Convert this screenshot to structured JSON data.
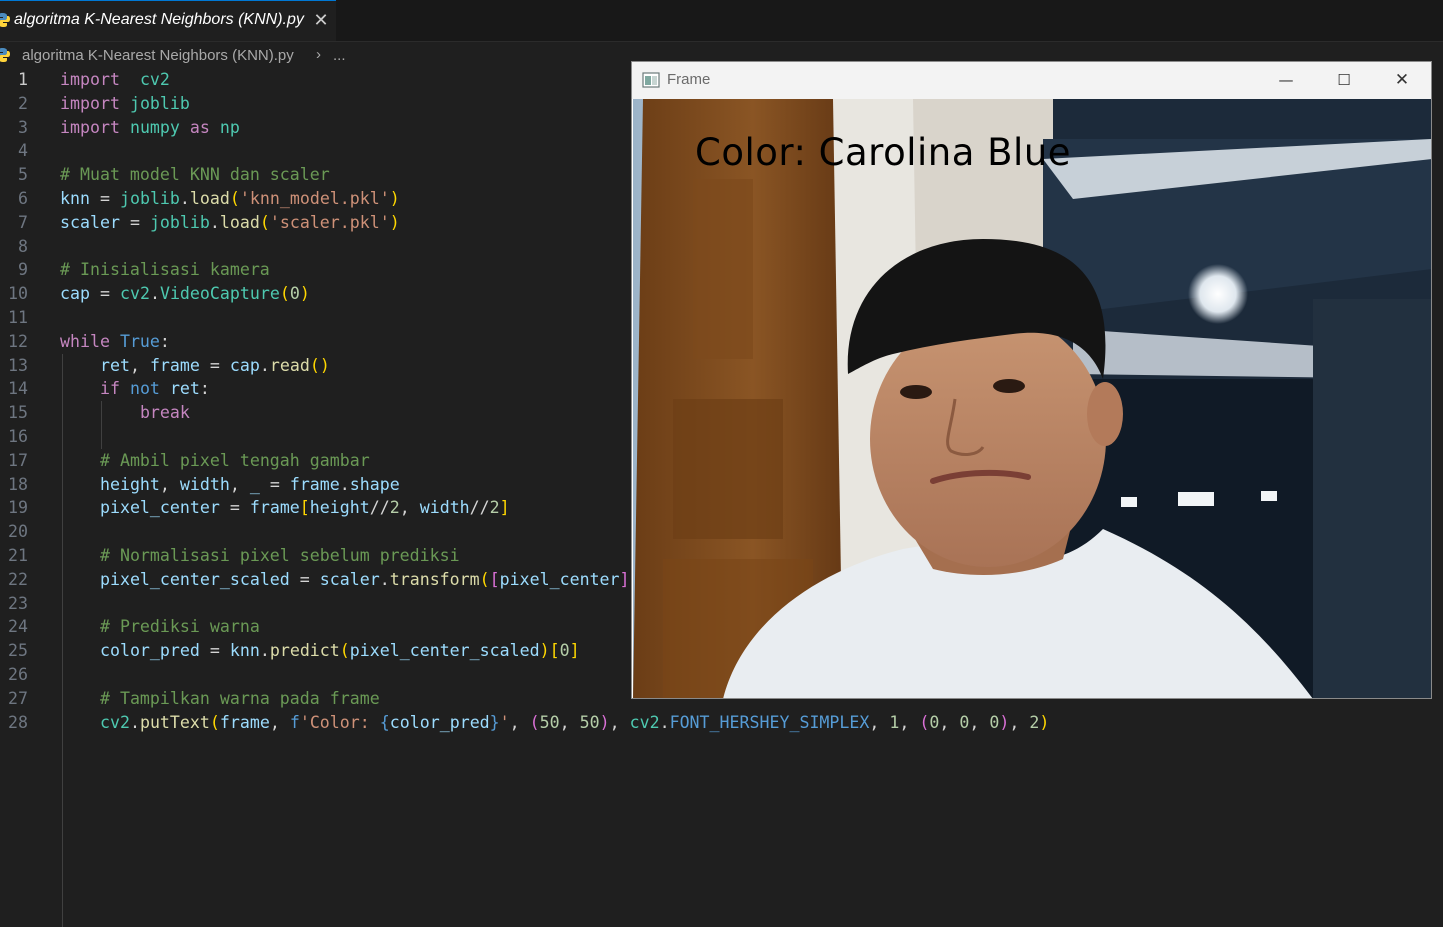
{
  "tab": {
    "filename": "algoritma K-Nearest Neighbors (KNN).py",
    "close_glyph": "✕"
  },
  "breadcrumb": {
    "file": "algoritma K-Nearest Neighbors (KNN).py",
    "separator": "›",
    "more": "..."
  },
  "editor": {
    "active_line": 1,
    "lines": [
      {
        "n": "1",
        "t": [
          [
            "kw",
            "import"
          ],
          [
            "",
            "  "
          ],
          [
            "mod",
            "cv2"
          ]
        ]
      },
      {
        "n": "2",
        "t": [
          [
            "kw",
            "import"
          ],
          [
            "",
            " "
          ],
          [
            "mod",
            "joblib"
          ]
        ]
      },
      {
        "n": "3",
        "t": [
          [
            "kw",
            "import"
          ],
          [
            "",
            " "
          ],
          [
            "mod",
            "numpy"
          ],
          [
            "",
            " "
          ],
          [
            "kw",
            "as"
          ],
          [
            "",
            " "
          ],
          [
            "mod",
            "np"
          ]
        ]
      },
      {
        "n": "4",
        "t": []
      },
      {
        "n": "5",
        "t": [
          [
            "com",
            "# Muat model KNN dan scaler"
          ]
        ]
      },
      {
        "n": "6",
        "t": [
          [
            "var",
            "knn"
          ],
          [
            "",
            " = "
          ],
          [
            "mod",
            "joblib"
          ],
          [
            "",
            "."
          ],
          [
            "fn",
            "load"
          ],
          [
            "b1",
            "("
          ],
          [
            "str",
            "'knn_model.pkl'"
          ],
          [
            "b1",
            ")"
          ]
        ]
      },
      {
        "n": "7",
        "t": [
          [
            "var",
            "scaler"
          ],
          [
            "",
            " = "
          ],
          [
            "mod",
            "joblib"
          ],
          [
            "",
            "."
          ],
          [
            "fn",
            "load"
          ],
          [
            "b1",
            "("
          ],
          [
            "str",
            "'scaler.pkl'"
          ],
          [
            "b1",
            ")"
          ]
        ]
      },
      {
        "n": "8",
        "t": []
      },
      {
        "n": "9",
        "t": [
          [
            "com",
            "# Inisialisasi kamera"
          ]
        ]
      },
      {
        "n": "10",
        "t": [
          [
            "var",
            "cap"
          ],
          [
            "",
            " = "
          ],
          [
            "mod",
            "cv2"
          ],
          [
            "",
            "."
          ],
          [
            "mod",
            "VideoCapture"
          ],
          [
            "b1",
            "("
          ],
          [
            "num",
            "0"
          ],
          [
            "b1",
            ")"
          ]
        ]
      },
      {
        "n": "11",
        "t": []
      },
      {
        "n": "12",
        "t": [
          [
            "kw",
            "while"
          ],
          [
            "",
            " "
          ],
          [
            "bk",
            "True"
          ],
          [
            "",
            ":"
          ]
        ]
      },
      {
        "n": "13",
        "t": [
          [
            "",
            "    "
          ],
          [
            "var",
            "ret"
          ],
          [
            "",
            ", "
          ],
          [
            "var",
            "frame"
          ],
          [
            "",
            " = "
          ],
          [
            "var",
            "cap"
          ],
          [
            "",
            "."
          ],
          [
            "fn",
            "read"
          ],
          [
            "b1",
            "()"
          ]
        ]
      },
      {
        "n": "14",
        "t": [
          [
            "",
            "    "
          ],
          [
            "kw",
            "if"
          ],
          [
            "",
            " "
          ],
          [
            "bk",
            "not"
          ],
          [
            "",
            " "
          ],
          [
            "var",
            "ret"
          ],
          [
            "",
            ":"
          ]
        ]
      },
      {
        "n": "15",
        "t": [
          [
            "",
            "        "
          ],
          [
            "kw",
            "break"
          ]
        ]
      },
      {
        "n": "16",
        "t": []
      },
      {
        "n": "17",
        "t": [
          [
            "",
            "    "
          ],
          [
            "com",
            "# Ambil pixel tengah gambar"
          ]
        ]
      },
      {
        "n": "18",
        "t": [
          [
            "",
            "    "
          ],
          [
            "var",
            "height"
          ],
          [
            "",
            ", "
          ],
          [
            "var",
            "width"
          ],
          [
            "",
            ", "
          ],
          [
            "var",
            "_"
          ],
          [
            "",
            " = "
          ],
          [
            "var",
            "frame"
          ],
          [
            "",
            "."
          ],
          [
            "var",
            "shape"
          ]
        ]
      },
      {
        "n": "19",
        "t": [
          [
            "",
            "    "
          ],
          [
            "var",
            "pixel_center"
          ],
          [
            "",
            " = "
          ],
          [
            "var",
            "frame"
          ],
          [
            "b1",
            "["
          ],
          [
            "var",
            "height"
          ],
          [
            "",
            "//"
          ],
          [
            "num",
            "2"
          ],
          [
            "",
            ", "
          ],
          [
            "var",
            "width"
          ],
          [
            "",
            "//"
          ],
          [
            "num",
            "2"
          ],
          [
            "b1",
            "]"
          ]
        ]
      },
      {
        "n": "20",
        "t": []
      },
      {
        "n": "21",
        "t": [
          [
            "",
            "    "
          ],
          [
            "com",
            "# Normalisasi pixel sebelum prediksi"
          ]
        ]
      },
      {
        "n": "22",
        "t": [
          [
            "",
            "    "
          ],
          [
            "var",
            "pixel_center_scaled"
          ],
          [
            "",
            " = "
          ],
          [
            "var",
            "scaler"
          ],
          [
            "",
            "."
          ],
          [
            "fn",
            "transform"
          ],
          [
            "b1",
            "("
          ],
          [
            "b2",
            "["
          ],
          [
            "var",
            "pixel_center"
          ],
          [
            "b2",
            "]"
          ],
          [
            "b1",
            ")"
          ]
        ]
      },
      {
        "n": "23",
        "t": []
      },
      {
        "n": "24",
        "t": [
          [
            "",
            "    "
          ],
          [
            "com",
            "# Prediksi warna"
          ]
        ]
      },
      {
        "n": "25",
        "t": [
          [
            "",
            "    "
          ],
          [
            "var",
            "color_pred"
          ],
          [
            "",
            " = "
          ],
          [
            "var",
            "knn"
          ],
          [
            "",
            "."
          ],
          [
            "fn",
            "predict"
          ],
          [
            "b1",
            "("
          ],
          [
            "var",
            "pixel_center_scaled"
          ],
          [
            "b1",
            ")"
          ],
          [
            "b1",
            "["
          ],
          [
            "num",
            "0"
          ],
          [
            "b1",
            "]"
          ]
        ]
      },
      {
        "n": "26",
        "t": []
      },
      {
        "n": "27",
        "t": [
          [
            "",
            "    "
          ],
          [
            "com",
            "# Tampilkan warna pada frame"
          ]
        ]
      },
      {
        "n": "28",
        "t": [
          [
            "",
            "    "
          ],
          [
            "mod",
            "cv2"
          ],
          [
            "",
            "."
          ],
          [
            "fn",
            "putText"
          ],
          [
            "b1",
            "("
          ],
          [
            "var",
            "frame"
          ],
          [
            "",
            ", "
          ],
          [
            "bk",
            "f"
          ],
          [
            "str",
            "'Color: "
          ],
          [
            "bk",
            "{"
          ],
          [
            "var",
            "color_pred"
          ],
          [
            "bk",
            "}"
          ],
          [
            "str",
            "'"
          ],
          [
            "",
            ", "
          ],
          [
            "b2",
            "("
          ],
          [
            "num",
            "50"
          ],
          [
            "",
            ", "
          ],
          [
            "num",
            "50"
          ],
          [
            "b2",
            ")"
          ],
          [
            "",
            ", "
          ],
          [
            "mod",
            "cv2"
          ],
          [
            "",
            "."
          ],
          [
            "bk",
            "FONT_HERSHEY_SIMPLEX"
          ],
          [
            "",
            ", "
          ],
          [
            "num",
            "1"
          ],
          [
            "",
            ", "
          ],
          [
            "b2",
            "("
          ],
          [
            "num",
            "0"
          ],
          [
            "",
            ", "
          ],
          [
            "num",
            "0"
          ],
          [
            "",
            ", "
          ],
          [
            "num",
            "0"
          ],
          [
            "b2",
            ")"
          ],
          [
            "",
            ", "
          ],
          [
            "num",
            "2"
          ],
          [
            "b1",
            ")"
          ]
        ]
      }
    ]
  },
  "frame_window": {
    "title": "Frame",
    "minimize_glyph": "—",
    "maximize_glyph": "☐",
    "close_glyph": "✕",
    "overlay_text": "Color: Carolina Blue"
  },
  "colors": {
    "editor_bg": "#1f1f1f",
    "accent": "#0078d4",
    "overlay_text": "#000000"
  }
}
